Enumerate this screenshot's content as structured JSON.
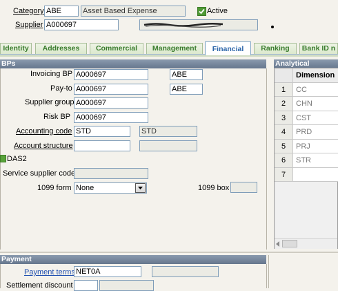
{
  "header": {
    "category_label": "Category",
    "category_value": "ABE",
    "category_desc": "Asset Based Expense",
    "active_label": "Active",
    "active_checked": true,
    "supplier_label": "Supplier",
    "supplier_value": "A000697"
  },
  "tabs": [
    {
      "label": "Identity",
      "active": false
    },
    {
      "label": "Addresses",
      "active": false
    },
    {
      "label": "Commercial",
      "active": false
    },
    {
      "label": "Management",
      "active": false
    },
    {
      "label": "Financial",
      "active": true
    },
    {
      "label": "Ranking",
      "active": false
    },
    {
      "label": "Bank ID n",
      "active": false
    }
  ],
  "bps": {
    "section_title": "BPs",
    "invoicing_bp_label": "Invoicing BP",
    "invoicing_bp_value": "A000697",
    "invoicing_bp_extra": "ABE",
    "payto_label": "Pay-to",
    "payto_value": "A000697",
    "payto_extra": "ABE",
    "supplier_group_label": "Supplier group",
    "supplier_group_value": "A000697",
    "risk_bp_label": "Risk BP",
    "risk_bp_value": "A000697",
    "accounting_code_label": "Accounting code",
    "accounting_code_value": "STD",
    "accounting_code_desc": "STD",
    "account_structure_label": "Account structure",
    "account_structure_value": "",
    "das2_label": "DAS2",
    "service_supplier_code_label": "Service supplier code",
    "service_supplier_code_value": "",
    "form1099_label": "1099 form",
    "form1099_value": "None",
    "box1099_label": "1099 box",
    "box1099_value": ""
  },
  "analytical": {
    "section_title": "Analytical",
    "column_header": "Dimension",
    "rows": [
      {
        "num": "1",
        "value": "CC"
      },
      {
        "num": "2",
        "value": "CHN"
      },
      {
        "num": "3",
        "value": "CST"
      },
      {
        "num": "4",
        "value": "PRD"
      },
      {
        "num": "5",
        "value": "PRJ"
      },
      {
        "num": "6",
        "value": "STR"
      },
      {
        "num": "7",
        "value": ""
      }
    ]
  },
  "payment": {
    "section_title": "Payment",
    "payment_terms_label": "Payment terms",
    "payment_terms_value": "NET0A",
    "settlement_discount_label": "Settlement discount"
  },
  "colors": {
    "tab_text": "#3a7d2e",
    "active_tab_text": "#2a64a8",
    "section_header": "#6f8095",
    "link": "#1f4fb0",
    "das2_marker": "#58a23a"
  }
}
